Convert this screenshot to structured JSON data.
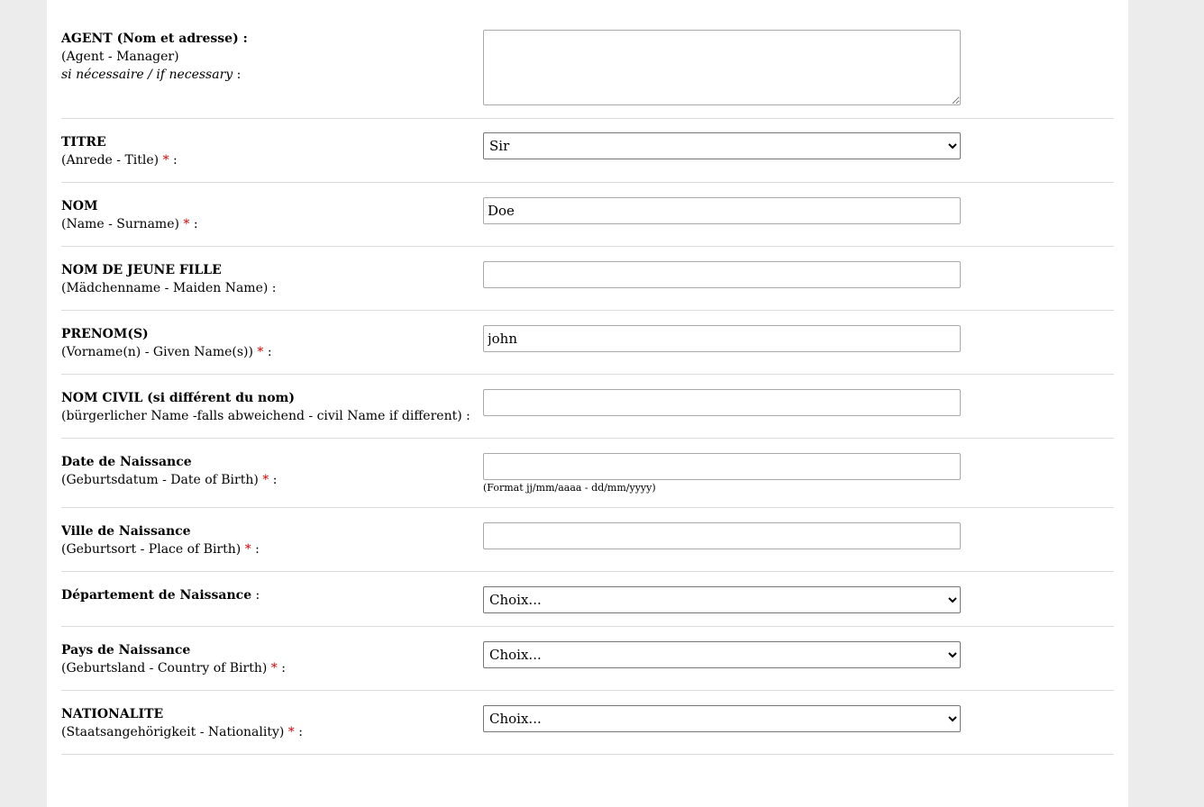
{
  "form": {
    "agent": {
      "line1": "AGENT (Nom et adresse) :",
      "line2": "(Agent - Manager)",
      "line3": "si nécessaire / if necessary",
      "line3_suffix": " :",
      "value": ""
    },
    "titre": {
      "line1": "TITRE",
      "line2": "(Anrede - Title)",
      "required": "*",
      "suffix": " :",
      "selected": "Sir"
    },
    "nom": {
      "line1": "NOM",
      "line2": "(Name - Surname)",
      "required": "*",
      "suffix": " :",
      "value": "Doe"
    },
    "nom_jeune_fille": {
      "line1": "NOM DE JEUNE FILLE",
      "line2": "(Mädchenname - Maiden Name) :",
      "value": ""
    },
    "prenoms": {
      "line1": "PRENOM(S)",
      "line2": "(Vorname(n) - Given Name(s))",
      "required": "*",
      "suffix": " :",
      "value": "john"
    },
    "nom_civil": {
      "line1": "NOM CIVIL (si différent du nom)",
      "line2": "(bürgerlicher Name -falls abweichend - civil Name if different) :",
      "value": ""
    },
    "date_naissance": {
      "line1": "Date de Naissance",
      "line2": "(Geburtsdatum - Date of Birth)",
      "required": "*",
      "suffix": " :",
      "value": "",
      "hint": "(Format jj/mm/aaaa - dd/mm/yyyy)"
    },
    "ville_naissance": {
      "line1": "Ville de Naissance",
      "line2": "(Geburtsort - Place of Birth)",
      "required": "*",
      "suffix": " :",
      "value": ""
    },
    "departement_naissance": {
      "line1": "Département de Naissance",
      "suffix": " :",
      "selected": "Choix..."
    },
    "pays_naissance": {
      "line1": "Pays de Naissance",
      "line2": "(Geburtsland - Country of Birth)",
      "required": "*",
      "suffix": " :",
      "selected": "Choix..."
    },
    "nationalite": {
      "line1": "NATIONALITE",
      "line2": "(Staatsangehörigkeit - Nationality)",
      "required": "*",
      "suffix": " :",
      "selected": "Choix..."
    }
  },
  "colors": {
    "page_background": "#ececec",
    "panel_background": "#ffffff",
    "required_marker": "#d00000",
    "row_divider": "#dcdcdc"
  }
}
